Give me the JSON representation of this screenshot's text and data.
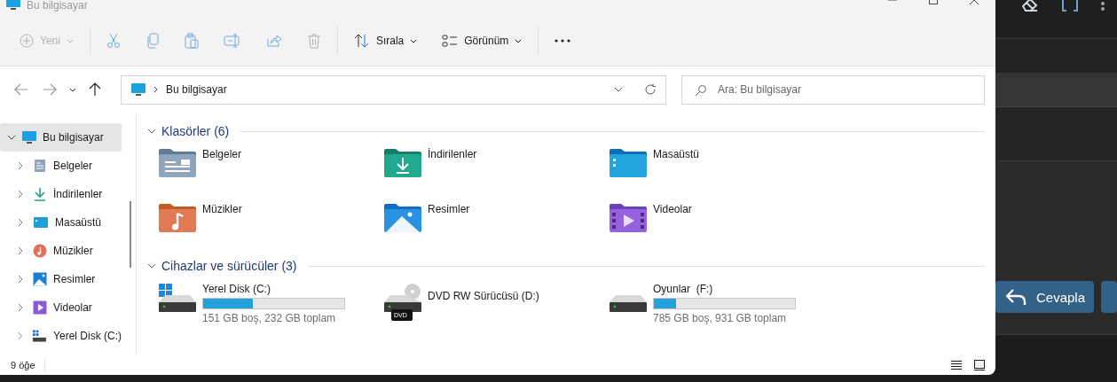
{
  "background": {
    "reply_button": "Cevapla"
  },
  "window": {
    "title": "Bu bilgisayar"
  },
  "toolbar": [
    {
      "kind": "new",
      "label": "Yeni",
      "disabled": true
    },
    {
      "kind": "cut",
      "disabled": true
    },
    {
      "kind": "copy",
      "disabled": true
    },
    {
      "kind": "paste",
      "disabled": true
    },
    {
      "kind": "rename",
      "disabled": true
    },
    {
      "kind": "share",
      "disabled": true
    },
    {
      "kind": "delete",
      "disabled": true
    },
    {
      "kind": "sort",
      "label": "Sırala",
      "disabled": false
    },
    {
      "kind": "view",
      "label": "Görünüm",
      "disabled": false
    },
    {
      "kind": "more",
      "disabled": false
    }
  ],
  "nav": [
    {
      "kind": "back",
      "disabled": true
    },
    {
      "kind": "forward",
      "disabled": true
    },
    {
      "kind": "recent",
      "disabled": false
    },
    {
      "kind": "up",
      "disabled": false
    }
  ],
  "address": {
    "path": "Bu bilgisayar"
  },
  "search": {
    "placeholder": "Ara: Bu bilgisayar"
  },
  "sidebar": {
    "items": [
      {
        "label": "Bu bilgisayar",
        "kind": "pc",
        "expanded": true,
        "selected": true,
        "children": [
          {
            "label": "Belgeler",
            "kind": "documents",
            "expanded": false,
            "selected": false
          },
          {
            "label": "İndirilenler",
            "kind": "downloads",
            "expanded": false,
            "selected": false
          },
          {
            "label": "Masaüstü",
            "kind": "desktop",
            "expanded": false,
            "selected": false
          },
          {
            "label": "Müzikler",
            "kind": "music",
            "expanded": false,
            "selected": false
          },
          {
            "label": "Resimler",
            "kind": "pictures",
            "expanded": false,
            "selected": false
          },
          {
            "label": "Videolar",
            "kind": "videos",
            "expanded": false,
            "selected": false
          },
          {
            "label": "Yerel Disk (C:)",
            "kind": "system-drive",
            "expanded": false,
            "selected": false
          }
        ]
      }
    ]
  },
  "sections": [
    {
      "title": "Klasörler (6)",
      "expanded": true,
      "items": [
        {
          "label": "Belgeler",
          "kind": "documents"
        },
        {
          "label": "İndirilenler",
          "kind": "downloads"
        },
        {
          "label": "Masaüstü",
          "kind": "desktop"
        },
        {
          "label": "Müzikler",
          "kind": "music"
        },
        {
          "label": "Resimler",
          "kind": "pictures"
        },
        {
          "label": "Videolar",
          "kind": "videos"
        }
      ]
    },
    {
      "title": "Cihazlar ve sürücüler (3)",
      "expanded": true,
      "items": [
        {
          "label": "Yerel Disk (C:)",
          "kind": "system-drive",
          "level": 0.35,
          "info": "151 GB boş, 232 GB toplam"
        },
        {
          "label": "DVD RW Sürücüsü (D:)",
          "kind": "dvd",
          "badge": "DVD"
        },
        {
          "label": "Oyunlar  (F:)",
          "kind": "drive",
          "level": 0.16,
          "info": "785 GB boş, 931 GB toplam"
        }
      ]
    }
  ],
  "status_bar": {
    "count": "9 öğe"
  }
}
